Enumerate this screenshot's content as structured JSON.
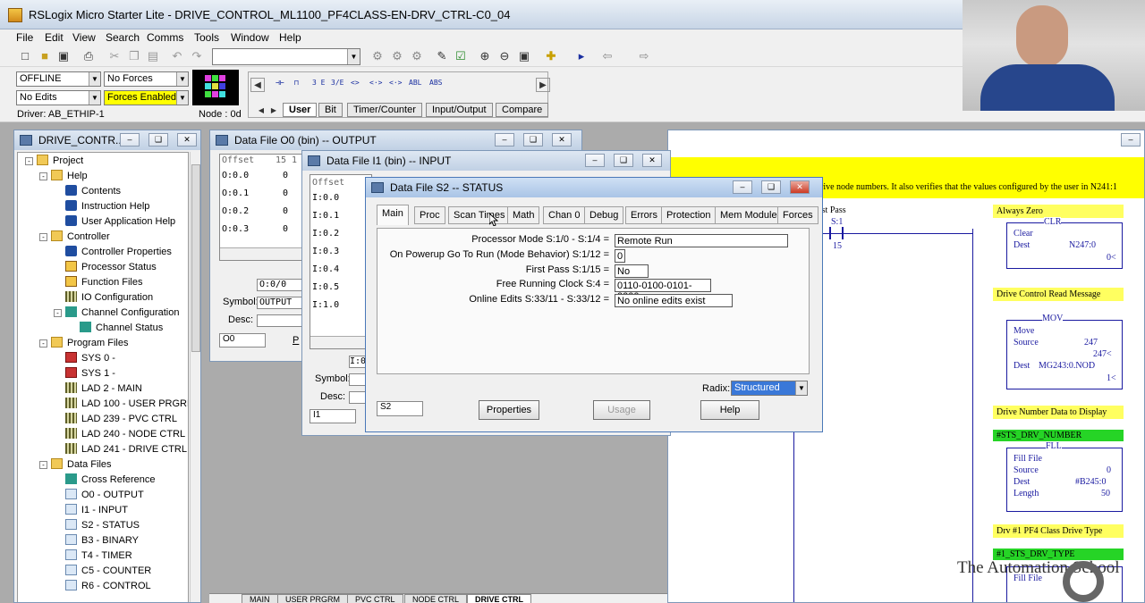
{
  "app": {
    "title": "RSLogix Micro Starter Lite - DRIVE_CONTROL_ML1100_PF4CLASS-EN-DRV_CTRL-C0_04"
  },
  "menu": [
    "File",
    "Edit",
    "View",
    "Search",
    "Comms",
    "Tools",
    "Window",
    "Help"
  ],
  "status": {
    "mode": "OFFLINE",
    "forces": "No Forces",
    "edits": "No Edits",
    "forces_enabled": "Forces Enabled",
    "driver": "Driver: AB_ETHIP-1",
    "node": "Node : 0d"
  },
  "instr_tabs": [
    "User",
    "Bit",
    "Timer/Counter",
    "Input/Output",
    "Compare"
  ],
  "instr_syms": [
    "⊣⊢",
    "⊓",
    "3 E",
    "3/E",
    "<>",
    "<·>",
    "<·>",
    "ABL",
    "ABS"
  ],
  "project": {
    "title": "DRIVE_CONTR...",
    "items": [
      {
        "label": "Project",
        "icon": "folder",
        "level": 0,
        "exp": "-"
      },
      {
        "label": "Help",
        "icon": "folder",
        "level": 1,
        "exp": "-"
      },
      {
        "label": "Contents",
        "icon": "info",
        "level": 2
      },
      {
        "label": "Instruction Help",
        "icon": "info",
        "level": 2
      },
      {
        "label": "User Application Help",
        "icon": "info",
        "level": 2
      },
      {
        "label": "Controller",
        "icon": "folder",
        "level": 1,
        "exp": "-"
      },
      {
        "label": "Controller Properties",
        "icon": "info",
        "level": 2
      },
      {
        "label": "Processor Status",
        "icon": "yell",
        "level": 2
      },
      {
        "label": "Function Files",
        "icon": "yell",
        "level": 2
      },
      {
        "label": "IO Configuration",
        "icon": "lad",
        "level": 2
      },
      {
        "label": "Channel Configuration",
        "icon": "book",
        "level": 2,
        "exp": "-"
      },
      {
        "label": "Channel Status",
        "icon": "book",
        "level": 3
      },
      {
        "label": "Program Files",
        "icon": "folder",
        "level": 1,
        "exp": "-"
      },
      {
        "label": "SYS 0 -",
        "icon": "red",
        "level": 2
      },
      {
        "label": "SYS 1 -",
        "icon": "red",
        "level": 2
      },
      {
        "label": "LAD 2 - MAIN",
        "icon": "lad",
        "level": 2
      },
      {
        "label": "LAD 100 - USER PRGRM",
        "icon": "lad",
        "level": 2
      },
      {
        "label": "LAD 239 - PVC CTRL",
        "icon": "lad",
        "level": 2
      },
      {
        "label": "LAD 240 - NODE CTRL",
        "icon": "lad",
        "level": 2
      },
      {
        "label": "LAD 241 - DRIVE CTRL",
        "icon": "lad",
        "level": 2
      },
      {
        "label": "Data Files",
        "icon": "folder",
        "level": 1,
        "exp": "-"
      },
      {
        "label": "Cross Reference",
        "icon": "book",
        "level": 2
      },
      {
        "label": "O0 - OUTPUT",
        "icon": "page",
        "level": 2
      },
      {
        "label": "I1 - INPUT",
        "icon": "page",
        "level": 2
      },
      {
        "label": "S2 - STATUS",
        "icon": "page",
        "level": 2
      },
      {
        "label": "B3 - BINARY",
        "icon": "page",
        "level": 2
      },
      {
        "label": "T4 - TIMER",
        "icon": "page",
        "level": 2
      },
      {
        "label": "C5 - COUNTER",
        "icon": "page",
        "level": 2
      },
      {
        "label": "R6 - CONTROL",
        "icon": "page",
        "level": 2
      }
    ]
  },
  "out_win": {
    "title": "Data File O0 (bin)  --  OUTPUT",
    "header": "Offset",
    "header2": "15 1",
    "rows": [
      [
        "O:0.0",
        "0"
      ],
      [
        "O:0.1",
        "0"
      ],
      [
        "O:0.2",
        "0"
      ],
      [
        "O:0.3",
        "0"
      ]
    ],
    "addr": "O:0/0",
    "symbol_label": "Symbol:",
    "symbol": "OUTPUT",
    "desc_label": "Desc:",
    "file": "O0",
    "btn": "P"
  },
  "in_win": {
    "title": "Data File I1 (bin)  --  INPUT",
    "header": "Offset",
    "rows": [
      "I:0.0",
      "I:0.1",
      "I:0.2",
      "I:0.3",
      "I:0.4",
      "I:0.5",
      "I:1.0"
    ],
    "addr": "I:0/",
    "symbol_label": "Symbol:",
    "desc_label": "Desc:",
    "file": "I1"
  },
  "stat_win": {
    "title": "Data File S2  --  STATUS",
    "tabs": [
      "Main",
      "Proc",
      "Scan Times",
      "Math",
      "Chan 0",
      "Debug",
      "Errors",
      "Protection",
      "Mem Module",
      "Forces"
    ],
    "fields": [
      [
        "Processor Mode S:1/0 - S:1/4 =",
        "Remote Run"
      ],
      [
        "On Powerup Go To Run (Mode Behavior) S:1/12 =",
        "0"
      ],
      [
        "First Pass S:1/15 =",
        "No"
      ],
      [
        "Free Running Clock S:4 =",
        "0110-0100-0101-0000"
      ],
      [
        "Online Edits S:33/11 - S:33/12 =",
        "No online edits exist"
      ]
    ],
    "radix_label": "Radix:",
    "radix": "Structured",
    "file": "S2",
    "properties": "Properties",
    "usage": "Usage",
    "help": "Help"
  },
  "ladder": {
    "banner": "rive node numbers.  It also verifies that the values configured by the user in N241:1",
    "first_pass": "First Pass",
    "s1": "S:1",
    "n15": "15",
    "always_zero": "Always Zero",
    "clr": "CLR",
    "clr_t": "Clear",
    "dest": "Dest",
    "n247": "N247:0",
    "zero": "0<",
    "dcr": "Drive Control Read Message",
    "mov": "MOV",
    "move": "Move",
    "source": "Source",
    "v247": "247",
    "v247b": "247<",
    "mgdest": "MG243:0.NOD",
    "one": "1<",
    "dnd": "Drive Number Data to Display",
    "tag1": "#STS_DRV_NUMBER",
    "fll": "FLL",
    "fill": "Fill File",
    "zero2": "0",
    "b245": "#B245:0",
    "length": "Length",
    "fifty": "50",
    "drv1": "Drv #1 PF4 Class Drive Type",
    "tag2": "#1_STS_DRV_TYPE",
    "fll2": "Fill File"
  },
  "sheets": [
    "MAIN",
    "USER PRGRM",
    "PVC CTRL",
    "NODE CTRL",
    "DRIVE CTRL"
  ],
  "watermark": "The Automation School"
}
